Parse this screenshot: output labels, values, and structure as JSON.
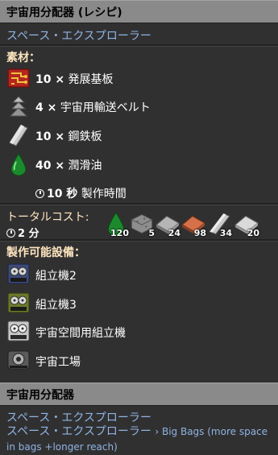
{
  "header": {
    "title": "宇宙用分配器 (レシピ)"
  },
  "mod_source": "スペース・エクスプローラー",
  "ingredients_title": "素材：",
  "ingredients": [
    {
      "icon": "circuit-board-icon",
      "qty": "10 ×",
      "name": "発展基板"
    },
    {
      "icon": "space-belt-icon",
      "qty": "4 ×",
      "name": "宇宙用輸送ベルト"
    },
    {
      "icon": "steel-plate-icon",
      "qty": "10 ×",
      "name": "鋼鉄板"
    },
    {
      "icon": "lubricant-icon",
      "qty": "40 ×",
      "name": "潤滑油"
    }
  ],
  "craft_time": {
    "value": "10 秒",
    "label": "製作時間"
  },
  "total_cost": {
    "label": "トータルコスト:",
    "time": "2 分",
    "items": [
      {
        "icon": "lubricant-icon",
        "count": "120"
      },
      {
        "icon": "concrete-icon",
        "count": "5"
      },
      {
        "icon": "stone-plate-icon",
        "count": "24"
      },
      {
        "icon": "copper-plate-icon",
        "count": "98"
      },
      {
        "icon": "steel-beam-icon",
        "count": "34"
      },
      {
        "icon": "iron-plate-icon",
        "count": "20"
      }
    ]
  },
  "made_in_title": "製作可能設備：",
  "machines": [
    {
      "icon": "assembler-2-icon",
      "name": "組立機2"
    },
    {
      "icon": "assembler-3-icon",
      "name": "組立機3"
    },
    {
      "icon": "space-assembler-icon",
      "name": "宇宙空間用組立機"
    },
    {
      "icon": "space-factory-icon",
      "name": "宇宙工場"
    }
  ],
  "footer": {
    "title": "宇宙用分配器",
    "mod_line_1": "スペース・エクスプローラー",
    "mod_line_2": "スペース・エクスプローラー",
    "mod_line_2_extra": "› Big Bags (more space in bags +longer reach)"
  },
  "colors": {
    "header_bg": "#8a8a8a",
    "panel_bg": "#313031",
    "link": "#8eb4e3",
    "section": "#ffe6c0"
  }
}
